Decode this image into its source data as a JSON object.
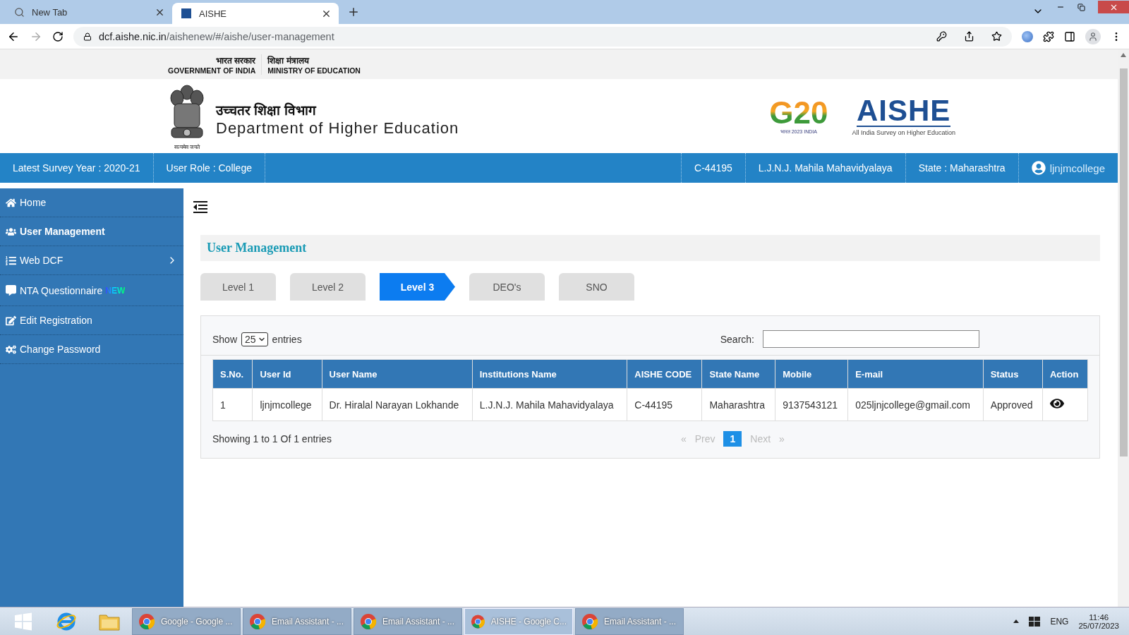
{
  "browser": {
    "tabs": [
      {
        "title": "New Tab",
        "selected": false,
        "kind": "search"
      },
      {
        "title": "AISHE",
        "selected": true,
        "kind": "site"
      }
    ],
    "url_host": "dcf.aishe.nic.in",
    "url_path": "/aishenew/#/aishe/user-management"
  },
  "gov_strip": [
    {
      "hindi": "भारत सरकार",
      "english": "GOVERNMENT OF INDIA"
    },
    {
      "hindi": "शिक्षा मंत्रालय",
      "english": "MINISTRY OF EDUCATION"
    }
  ],
  "header": {
    "emblem_motto": "सत्यमेव जयते",
    "hindi_title": "उच्चतर शिक्षा विभाग",
    "title": "Department of Higher Education",
    "g20_logo": "G20",
    "g20_caption": "भारत 2023 INDIA",
    "aishe_logo": "AISHE",
    "aishe_caption": "All India Survey on Higher Education"
  },
  "info_bar": {
    "left": [
      "Latest Survey Year : 2020-21",
      "User Role : College"
    ],
    "right": [
      "C-44195",
      "L.J.N.J. Mahila Mahavidyalaya",
      "State : Maharashtra"
    ],
    "user": "ljnjmcollege"
  },
  "sidebar": {
    "items": [
      {
        "label": "Home",
        "kind": "home",
        "selected": false,
        "expandable": false
      },
      {
        "label": "User Management",
        "kind": "users",
        "selected": true,
        "expandable": false
      },
      {
        "label": "Web DCF",
        "kind": "list",
        "selected": false,
        "expandable": true
      },
      {
        "label": "NTA Questionnaire",
        "kind": "chat",
        "selected": false,
        "expandable": false,
        "badge": "NEW"
      },
      {
        "label": "Edit Registration",
        "kind": "edit",
        "selected": false,
        "expandable": false
      },
      {
        "label": "Change Password",
        "kind": "cogs",
        "selected": false,
        "expandable": false
      }
    ]
  },
  "page_title": "User Management",
  "tabs": [
    {
      "label": "Level 1",
      "selected": false
    },
    {
      "label": "Level 2",
      "selected": false
    },
    {
      "label": "Level 3",
      "selected": true
    },
    {
      "label": "DEO's",
      "selected": false
    },
    {
      "label": "SNO",
      "selected": false
    }
  ],
  "table_controls": {
    "show_label": "Show",
    "page_size": "25",
    "entries_label": "entries",
    "search_label": "Search:"
  },
  "table": {
    "columns": [
      "S.No.",
      "User Id",
      "User Name",
      "Institutions Name",
      "AISHE CODE",
      "State Name",
      "Mobile",
      "E-mail",
      "Status",
      "Action"
    ],
    "rows": [
      [
        "1",
        "ljnjmcollege",
        "Dr. Hiralal Narayan Lokhande",
        "L.J.N.J. Mahila Mahavidyalaya",
        "C-44195",
        "Maharashtra",
        "9137543121",
        "025ljnjcollege@gmail.com",
        "Approved"
      ]
    ]
  },
  "table_footer": {
    "summary": "Showing 1 to 1 Of 1 entries",
    "first": "«",
    "prev": "Prev",
    "pages": [
      {
        "label": "1",
        "selected": true
      }
    ],
    "next": "Next",
    "last": "»",
    "prev_disabled": true,
    "next_disabled": true
  },
  "taskbar": {
    "items": [
      {
        "title": "Google - Google ...",
        "selected": false
      },
      {
        "title": "Email Assistant - ...",
        "selected": false
      },
      {
        "title": "Email Assistant - ...",
        "selected": false
      },
      {
        "title": "AISHE - Google C...",
        "selected": true
      },
      {
        "title": "Email Assistant - ...",
        "selected": false
      }
    ],
    "language": "ENG",
    "time": "11:46",
    "date": "25/07/2023"
  }
}
